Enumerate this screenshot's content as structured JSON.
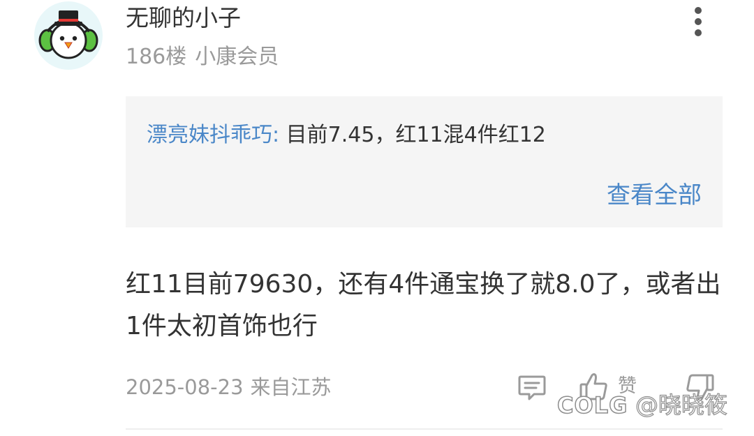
{
  "post": {
    "username": "无聊的小子",
    "floor": "186楼",
    "member_badge": "小康会员",
    "comment_text": "红11目前79630，还有4件通宝换了就8.0了，或者出1件太初首饰也行",
    "date": "2025-08-23",
    "location": "来自江苏"
  },
  "reply_preview": {
    "author": "漂亮妹抖乖巧",
    "separator": ":",
    "text": " 目前7.45，红11混4件红12",
    "view_all_label": "查看全部"
  },
  "actions": {
    "like_label": "赞"
  },
  "watermark": {
    "logo": "COLG",
    "handle": "@晓晓筱"
  },
  "icons": {
    "avatar": "snowman-avatar",
    "more": "more-vertical-icon",
    "comment": "comment-icon",
    "like": "thumbs-up-icon",
    "dislike": "thumbs-down-icon"
  },
  "colors": {
    "link_blue": "#4a87c8",
    "text": "#333333",
    "muted": "#9a9a9a",
    "reply_bg": "#f5f5f5",
    "avatar_bg": "#e8f7f9",
    "avatar_ear_green": "#5cc142"
  }
}
